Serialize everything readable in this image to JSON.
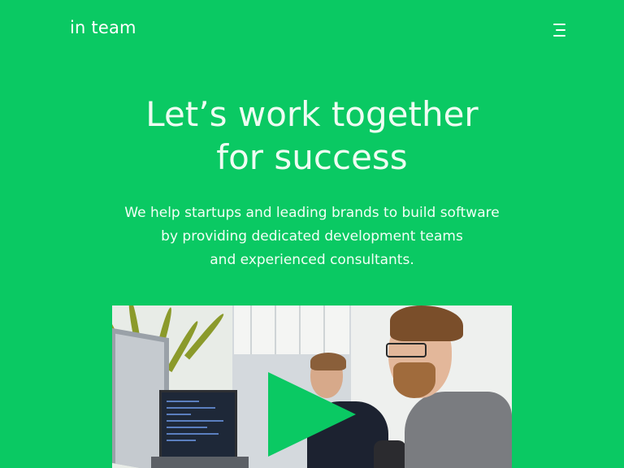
{
  "header": {
    "logo_text": "in team",
    "menu_icon": "hamburger-menu-icon"
  },
  "hero": {
    "title_lines": [
      "Let’s work together",
      "for success"
    ],
    "subtitle_lines": [
      "We help startups and leading brands to build software",
      "by providing dedicated development teams",
      "and experienced consultants."
    ]
  },
  "video": {
    "play_icon": "play-icon"
  },
  "colors": {
    "background": "#0ac963",
    "text": "#ffffff"
  }
}
